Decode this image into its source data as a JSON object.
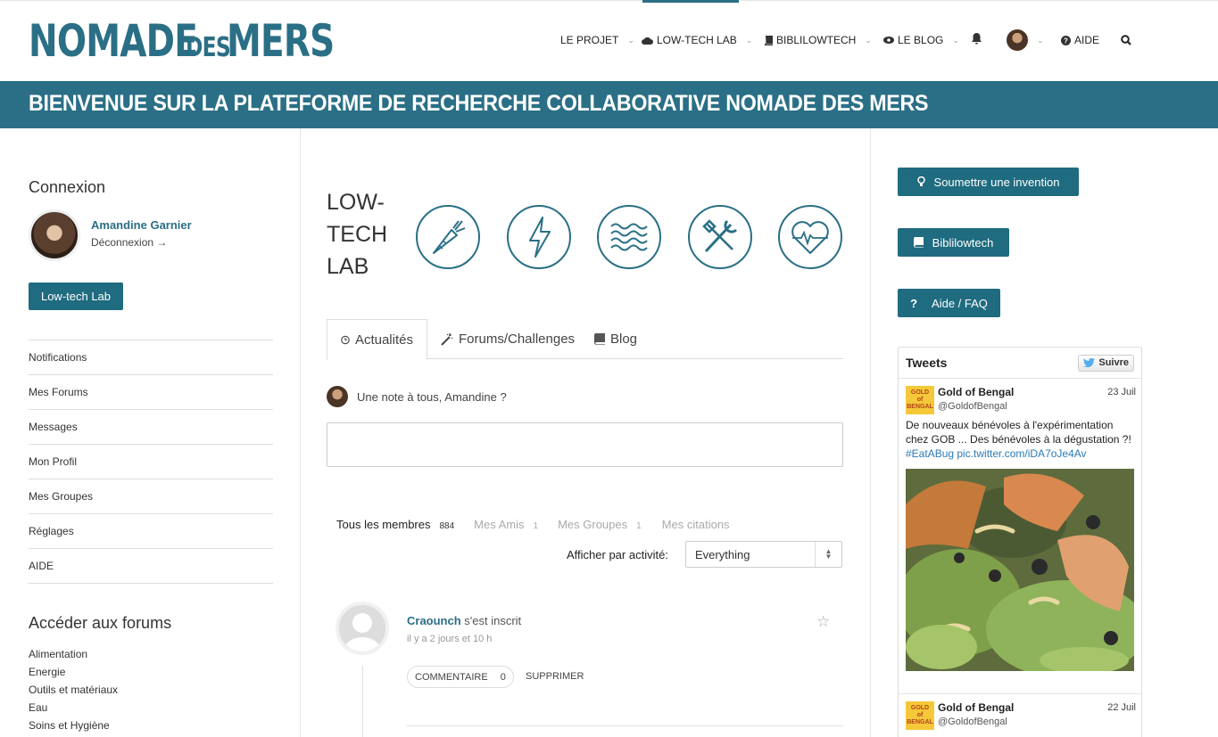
{
  "header": {
    "logo_part1": "NOMADE",
    "logo_part2": "DES",
    "logo_part3": "MERS",
    "nav": {
      "projet": "LE PROJET",
      "lowtech": "LOW-TECH LAB",
      "biblio": "BIBLILOWTECH",
      "blog": "LE BLOG",
      "aide": "AIDE"
    }
  },
  "banner": {
    "title": "BIENVENUE SUR LA PLATEFORME DE RECHERCHE COLLABORATIVE NOMADE DES MERS"
  },
  "left": {
    "connexion_title": "Connexion",
    "user_name": "Amandine Garnier",
    "logout": "Déconnexion →",
    "lowtech_button": "Low-tech Lab",
    "menu": [
      {
        "label": "Notifications"
      },
      {
        "label": "Mes Forums"
      },
      {
        "label": "Messages"
      },
      {
        "label": "Mon Profil"
      },
      {
        "label": "Mes Groupes"
      },
      {
        "label": "Réglages"
      },
      {
        "label": "AIDE"
      }
    ],
    "forums_title": "Accéder aux forums",
    "forums": [
      {
        "label": "Alimentation"
      },
      {
        "label": "Energie"
      },
      {
        "label": "Outils et matériaux"
      },
      {
        "label": "Eau"
      },
      {
        "label": "Soins et Hygiène"
      }
    ]
  },
  "center": {
    "lowtech_title_1": "LOW-",
    "lowtech_title_2": "TECH",
    "lowtech_title_3": "LAB",
    "tabs": {
      "actualites": "Actualités",
      "forums": "Forums/Challenges",
      "blog": "Blog"
    },
    "note_prompt": "Une note à tous, Amandine ?",
    "filters": {
      "tous": "Tous les membres",
      "tous_count": "884",
      "amis": "Mes Amis",
      "amis_count": "1",
      "groupes": "Mes Groupes",
      "groupes_count": "1",
      "citations": "Mes citations"
    },
    "show_label": "Afficher par activité:",
    "show_value": "Everything",
    "activity": {
      "user": "Craounch",
      "action": " s'est inscrit",
      "time": "il y a 2 jours et 10 h",
      "comment_label": "COMMENTAIRE",
      "comment_count": "0",
      "delete_label": "SUPPRIMER"
    }
  },
  "right": {
    "submit_button": "Soumettre une invention",
    "biblio_button": "Biblilowtech",
    "faq_button": "Aide / FAQ",
    "tweets_title": "Tweets",
    "follow_label": "Suivre",
    "tweets": [
      {
        "name": "Gold of Bengal",
        "handle": "@GoldofBengal",
        "date": "23 Juil",
        "text": "De nouveaux bénévoles à l'expérimentation chez GOB ... Des bénévoles à la dégustation ?! ",
        "link": "#EatABug pic.twitter.com/iDA7oJe4Av"
      },
      {
        "name": "Gold of Bengal",
        "handle": "@GoldofBengal",
        "date": "22 Juil"
      }
    ]
  },
  "colors": {
    "brand": "#2a6f86",
    "button": "#1f6b7f"
  }
}
